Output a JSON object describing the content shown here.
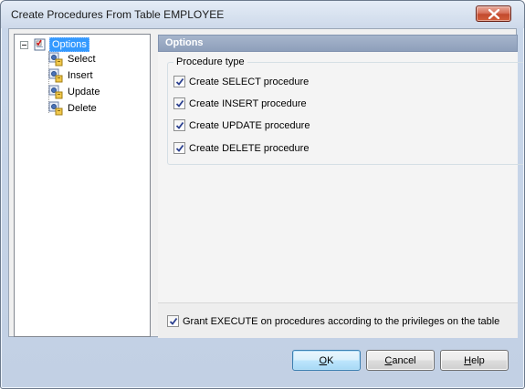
{
  "window": {
    "title": "Create Procedures From Table EMPLOYEE"
  },
  "tree": {
    "root": {
      "label": "Options",
      "icon": "options-checklist-icon",
      "selected": true
    },
    "children": [
      {
        "label": "Select",
        "icon": "procedure-gear-icon"
      },
      {
        "label": "Insert",
        "icon": "procedure-gear-icon"
      },
      {
        "label": "Update",
        "icon": "procedure-gear-icon"
      },
      {
        "label": "Delete",
        "icon": "procedure-gear-icon"
      }
    ]
  },
  "panel": {
    "header": "Options",
    "group_caption": "Procedure type",
    "checks": [
      {
        "label": "Create SELECT procedure",
        "checked": true
      },
      {
        "label": "Create INSERT procedure",
        "checked": true
      },
      {
        "label": "Create UPDATE procedure",
        "checked": true
      },
      {
        "label": "Create DELETE procedure",
        "checked": true
      }
    ],
    "grant": {
      "label": "Grant EXECUTE on procedures according to the privileges on the table",
      "checked": true
    }
  },
  "buttons": {
    "ok": {
      "mnemonic": "O",
      "rest": "K"
    },
    "cancel": {
      "mnemonic": "C",
      "rest": "ancel"
    },
    "help": {
      "mnemonic": "H",
      "rest": "elp"
    }
  },
  "colors": {
    "selection": "#3399ff",
    "panel_header": "#97a7c1",
    "default_button_border": "#3c7fb1"
  }
}
